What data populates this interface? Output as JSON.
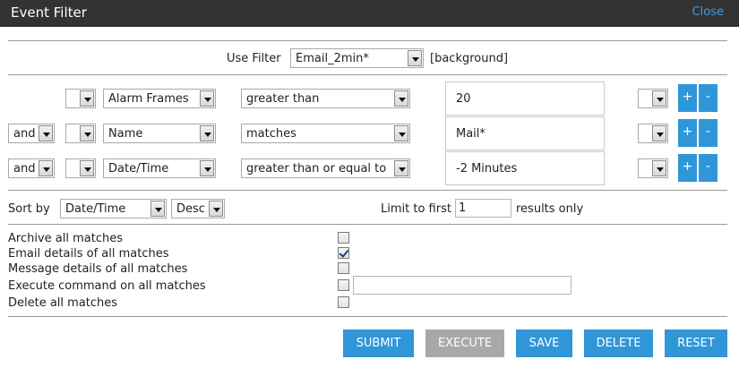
{
  "dialog": {
    "title": "Event Filter",
    "close_label": "Close"
  },
  "use_filter": {
    "label": "Use Filter",
    "selected": "Email_2min*",
    "note": "[background]"
  },
  "filter_rows": [
    {
      "conjunction": "",
      "paren_open": "",
      "attribute": "Alarm Frames",
      "operator": "greater than",
      "value": "20",
      "paren_close": "",
      "add_label": "+",
      "remove_label": "-"
    },
    {
      "conjunction": "and",
      "paren_open": "",
      "attribute": "Name",
      "operator": "matches",
      "value": "Mail*",
      "paren_close": "",
      "add_label": "+",
      "remove_label": "-"
    },
    {
      "conjunction": "and",
      "paren_open": "",
      "attribute": "Date/Time",
      "operator": "greater than or equal to",
      "value": "-2 Minutes",
      "paren_close": "",
      "add_label": "+",
      "remove_label": "-"
    }
  ],
  "sort": {
    "label": "Sort by",
    "field": "Date/Time",
    "direction": "Desc"
  },
  "limit": {
    "label": "Limit to first",
    "value": "1",
    "suffix": "results only"
  },
  "actions": [
    {
      "label": "Archive all matches",
      "checked": false
    },
    {
      "label": "Email details of all matches",
      "checked": true
    },
    {
      "label": "Message details of all matches",
      "checked": false
    },
    {
      "label": "Execute command on all matches",
      "checked": false,
      "command": ""
    },
    {
      "label": "Delete all matches",
      "checked": false
    }
  ],
  "buttons": {
    "submit": "SUBMIT",
    "execute": "EXECUTE",
    "save": "SAVE",
    "delete": "DELETE",
    "reset": "RESET"
  },
  "colors": {
    "accent": "#2f96d8",
    "titlebar": "#333333",
    "disabled": "#a8a8a8",
    "link": "#3b9de1"
  }
}
